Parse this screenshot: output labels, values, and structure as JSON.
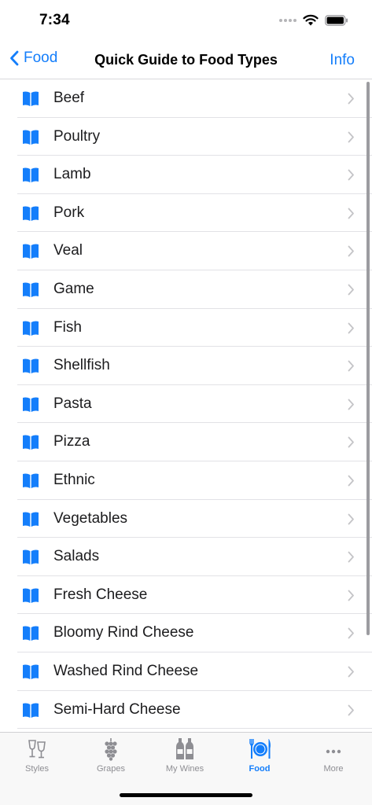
{
  "status": {
    "time": "7:34"
  },
  "nav": {
    "back_label": "Food",
    "title": "Quick Guide to Food Types",
    "info_label": "Info"
  },
  "colors": {
    "accent": "#147efb",
    "inactive": "#8e8e93"
  },
  "list": {
    "icon": "book-icon",
    "items": [
      "Beef",
      "Poultry",
      "Lamb",
      "Pork",
      "Veal",
      "Game",
      "Fish",
      "Shellfish",
      "Pasta",
      "Pizza",
      "Ethnic",
      "Vegetables",
      "Salads",
      "Fresh Cheese",
      "Bloomy Rind Cheese",
      "Washed Rind Cheese",
      "Semi-Hard Cheese"
    ]
  },
  "tabs": [
    {
      "label": "Styles",
      "icon": "wine-glasses-icon"
    },
    {
      "label": "Grapes",
      "icon": "grapes-icon"
    },
    {
      "label": "My Wines",
      "icon": "wine-bottles-icon"
    },
    {
      "label": "Food",
      "icon": "plate-fork-knife-icon",
      "active": true
    },
    {
      "label": "More",
      "icon": "more-dots-icon"
    }
  ]
}
